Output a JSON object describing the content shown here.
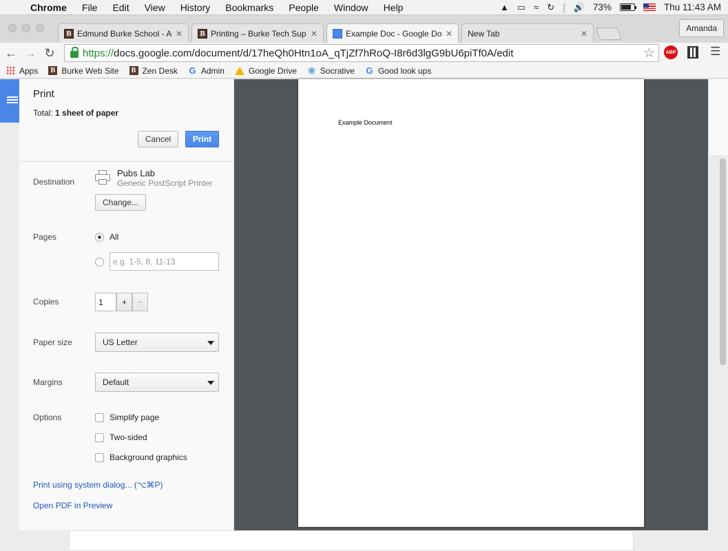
{
  "menubar": {
    "app": "Chrome",
    "items": [
      "File",
      "Edit",
      "View",
      "History",
      "Bookmarks",
      "People",
      "Window",
      "Help"
    ],
    "battery": "73%",
    "clock": "Thu 11:43 AM"
  },
  "tabs": [
    {
      "label": "Edmund Burke School - Ag",
      "favicon": "B"
    },
    {
      "label": "Printing – Burke Tech Supp",
      "favicon": "B"
    },
    {
      "label": "Example Doc - Google Doc",
      "favicon": "docs-icon"
    },
    {
      "label": "New Tab",
      "favicon": ""
    }
  ],
  "profile": "Amanda",
  "omnibox": {
    "scheme": "https://",
    "rest": "docs.google.com/document/d/17heQh0Htn1oA_qTjZf7hRoQ-I8r6d3lgG9bU6piTf0A/edit"
  },
  "extensions": {
    "adblock": "ABP"
  },
  "bookmarks": [
    {
      "label": "Apps",
      "icon": "apps-grid-icon"
    },
    {
      "label": "Burke Web Site",
      "icon": "B"
    },
    {
      "label": "Zen Desk",
      "icon": "B"
    },
    {
      "label": "Admin",
      "icon": "google-icon"
    },
    {
      "label": "Google Drive",
      "icon": "drive-icon"
    },
    {
      "label": "Socrative",
      "icon": "socrative-icon"
    },
    {
      "label": "Good look ups",
      "icon": "google-icon"
    }
  ],
  "print": {
    "title": "Print",
    "total_prefix": "Total: ",
    "total_value": "1 sheet of paper",
    "cancel": "Cancel",
    "print": "Print",
    "destination_label": "Destination",
    "printer_name": "Pubs Lab",
    "printer_type": "Generic PostScript Printer",
    "change": "Change...",
    "pages_label": "Pages",
    "pages_all": "All",
    "pages_placeholder": "e.g. 1-5, 8, 11-13",
    "copies_label": "Copies",
    "copies_value": "1",
    "plus": "+",
    "minus": "−",
    "paper_size_label": "Paper size",
    "paper_size_value": "US Letter",
    "margins_label": "Margins",
    "margins_value": "Default",
    "options_label": "Options",
    "options": [
      "Simplify page",
      "Two-sided",
      "Background graphics"
    ],
    "system_dialog_link": "Print using system dialog... (⌥⌘P)",
    "open_pdf_link": "Open PDF in Preview"
  },
  "preview": {
    "doc_text": "Example Document"
  }
}
